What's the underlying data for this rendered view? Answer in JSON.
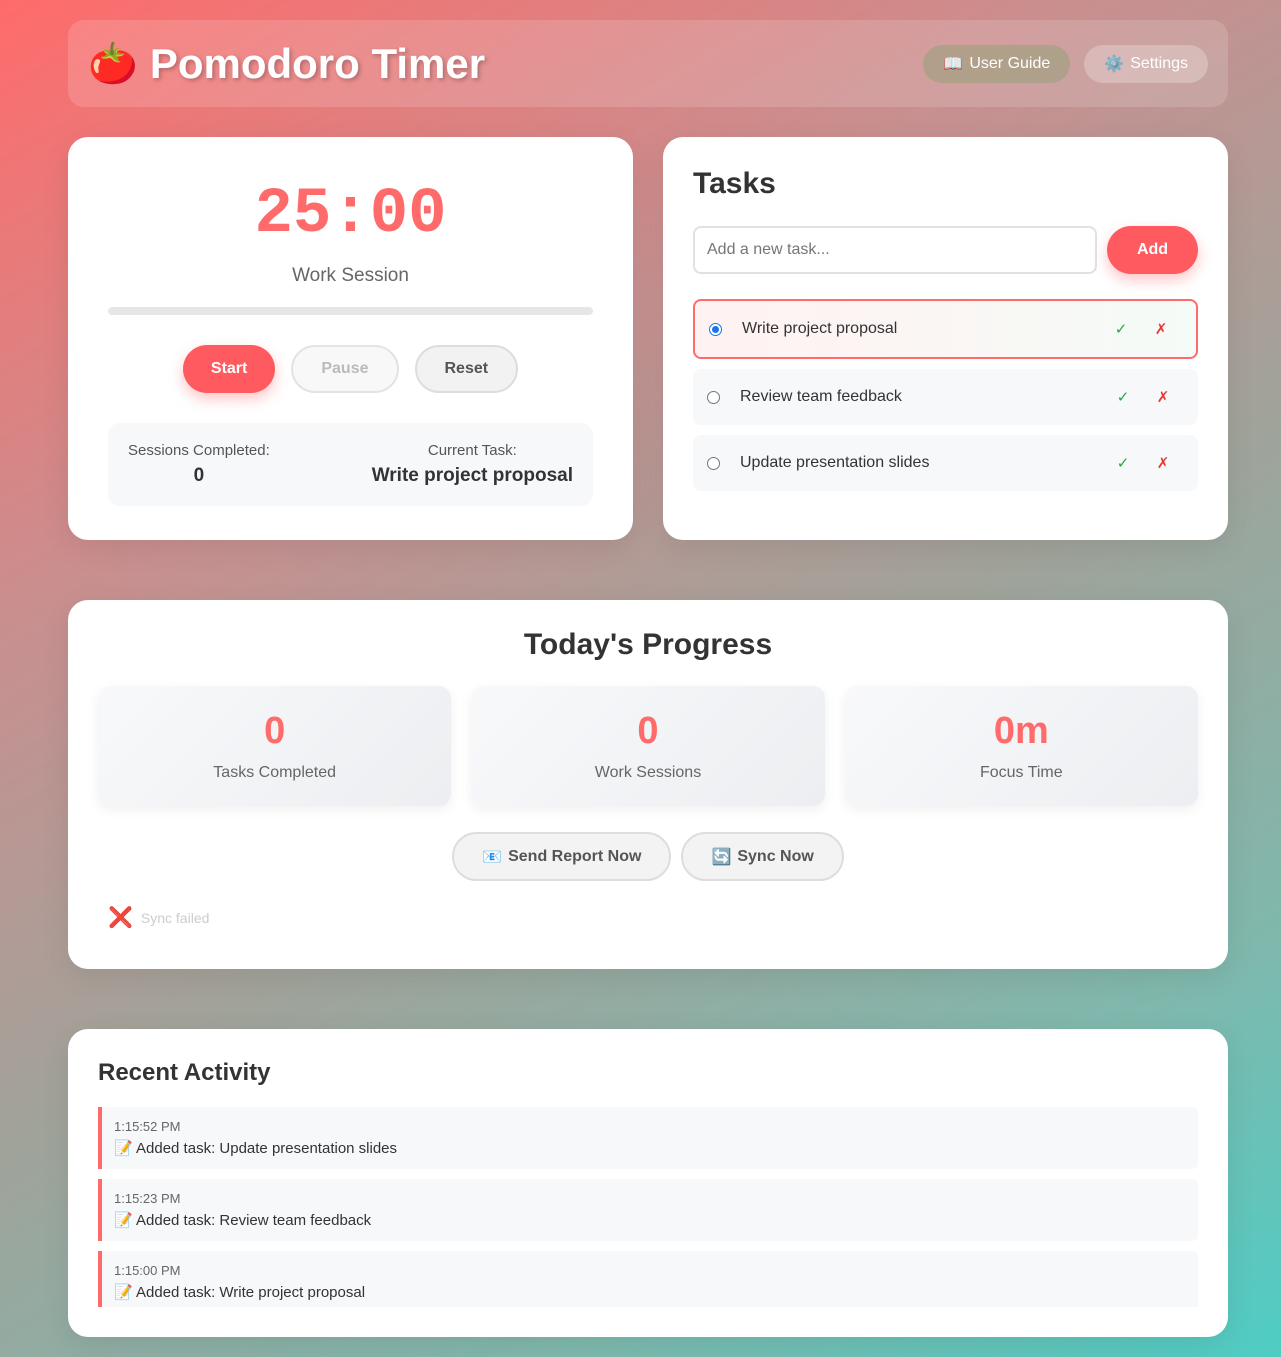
{
  "header": {
    "logo_emoji": "🍅",
    "title": "Pomodoro Timer",
    "guide_icon": "📖",
    "guide_label": "User Guide",
    "settings_icon": "⚙️",
    "settings_label": "Settings"
  },
  "timer": {
    "display": "25:00",
    "session_type": "Work Session",
    "progress_percent": 0,
    "start_label": "Start",
    "pause_label": "Pause",
    "reset_label": "Reset",
    "sessions_label": "Sessions Completed:",
    "sessions_value": "0",
    "current_task_label": "Current Task:",
    "current_task_value": "Write project proposal"
  },
  "tasks": {
    "title": "Tasks",
    "input_placeholder": "Add a new task...",
    "add_label": "Add",
    "complete_glyph": "✓",
    "delete_glyph": "✗",
    "items": [
      {
        "text": "Write project proposal",
        "selected": true
      },
      {
        "text": "Review team feedback",
        "selected": false
      },
      {
        "text": "Update presentation slides",
        "selected": false
      }
    ]
  },
  "progress": {
    "title": "Today's Progress",
    "stats": [
      {
        "value": "0",
        "label": "Tasks Completed"
      },
      {
        "value": "0",
        "label": "Work Sessions"
      },
      {
        "value": "0m",
        "label": "Focus Time"
      }
    ],
    "send_report_icon": "📧",
    "send_report_label": "Send Report Now",
    "sync_icon": "🔄",
    "sync_label": "Sync Now",
    "sync_status_icon": "❌",
    "sync_status_text": "Sync failed"
  },
  "activity": {
    "title": "Recent Activity",
    "items": [
      {
        "time": "1:15:52 PM",
        "message": "📝 Added task: Update presentation slides"
      },
      {
        "time": "1:15:23 PM",
        "message": "📝 Added task: Review team feedback"
      },
      {
        "time": "1:15:00 PM",
        "message": "📝 Added task: Write project proposal"
      }
    ]
  },
  "colors": {
    "accent": "#ff6b6b",
    "complete": "#28a745",
    "delete": "#e53935"
  }
}
